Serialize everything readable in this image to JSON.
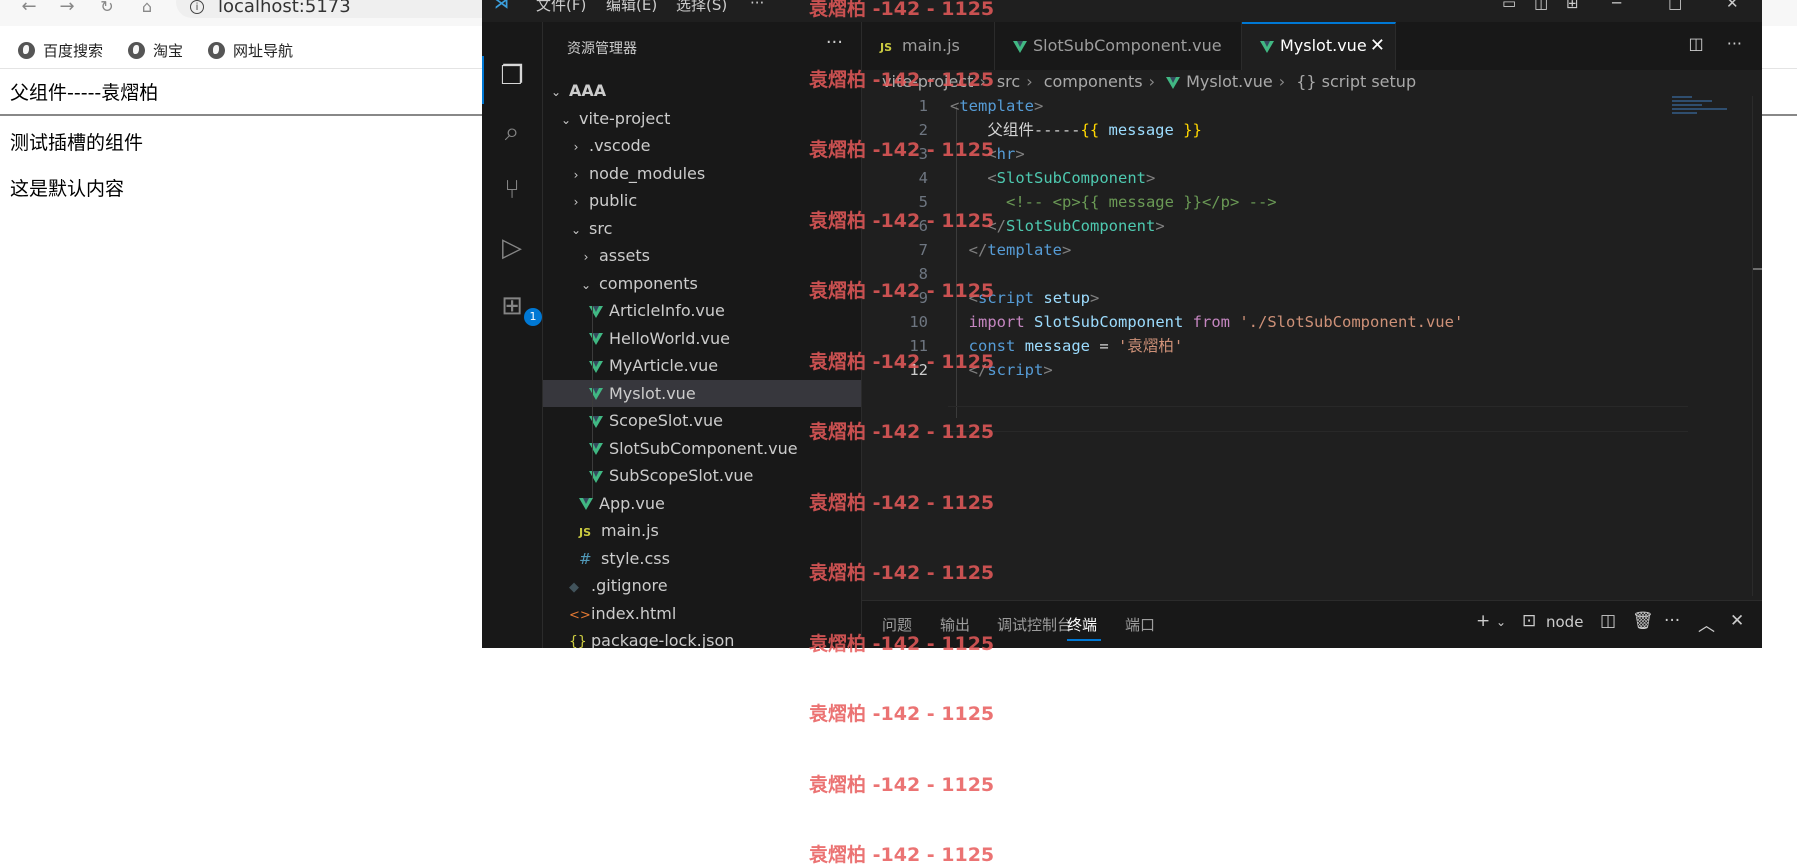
{
  "browser": {
    "url": "localhost:5173",
    "bookmarks": [
      "百度搜索",
      "淘宝",
      "网址导航"
    ]
  },
  "page": {
    "title": "父组件-----袁熠柏",
    "p1": "测试插槽的组件",
    "p2": "这是默认内容"
  },
  "vscode": {
    "menus": [
      "文件(F)",
      "编辑(E)",
      "选择(S)",
      "···"
    ],
    "explorer_title": "资源管理器",
    "more": "···",
    "tree": [
      {
        "label": "AAA",
        "indent": 0,
        "type": "folder-open",
        "bold": true
      },
      {
        "label": "vite-project",
        "indent": 1,
        "type": "folder-open"
      },
      {
        "label": ".vscode",
        "indent": 2,
        "type": "folder"
      },
      {
        "label": "node_modules",
        "indent": 2,
        "type": "folder"
      },
      {
        "label": "public",
        "indent": 2,
        "type": "folder"
      },
      {
        "label": "src",
        "indent": 2,
        "type": "folder-open"
      },
      {
        "label": "assets",
        "indent": 3,
        "type": "folder"
      },
      {
        "label": "components",
        "indent": 3,
        "type": "folder-open"
      },
      {
        "label": "ArticleInfo.vue",
        "indent": 4,
        "type": "vue"
      },
      {
        "label": "HelloWorld.vue",
        "indent": 4,
        "type": "vue"
      },
      {
        "label": "MyArticle.vue",
        "indent": 4,
        "type": "vue"
      },
      {
        "label": "Myslot.vue",
        "indent": 4,
        "type": "vue",
        "selected": true
      },
      {
        "label": "ScopeSlot.vue",
        "indent": 4,
        "type": "vue"
      },
      {
        "label": "SlotSubComponent.vue",
        "indent": 4,
        "type": "vue"
      },
      {
        "label": "SubScopeSlot.vue",
        "indent": 4,
        "type": "vue"
      },
      {
        "label": "App.vue",
        "indent": 3,
        "type": "vue"
      },
      {
        "label": "main.js",
        "indent": 3,
        "type": "js"
      },
      {
        "label": "style.css",
        "indent": 3,
        "type": "css"
      },
      {
        "label": ".gitignore",
        "indent": 2,
        "type": "git"
      },
      {
        "label": "index.html",
        "indent": 2,
        "type": "html"
      },
      {
        "label": "package-lock.json",
        "indent": 2,
        "type": "json"
      }
    ],
    "tabs": [
      {
        "label": "main.js",
        "icon": "js"
      },
      {
        "label": "SlotSubComponent.vue",
        "icon": "vue"
      },
      {
        "label": "Myslot.vue",
        "icon": "vue",
        "active": true
      }
    ],
    "breadcrumb": [
      "vite-project",
      "src",
      "components",
      "Myslot.vue",
      "script setup"
    ],
    "breadcrumb_script_icon": "{}",
    "code_lines": [
      [
        [
          "t-br",
          "<"
        ],
        [
          "t-tag",
          "template"
        ],
        [
          "t-br",
          ">"
        ]
      ],
      [
        [
          "t-txt",
          "    父组件-----"
        ],
        [
          "t-mus",
          "{{ "
        ],
        [
          "t-id",
          "message"
        ],
        [
          "t-mus",
          " }}"
        ]
      ],
      [
        [
          "t-txt",
          "    "
        ],
        [
          "t-br",
          "<"
        ],
        [
          "t-tag",
          "hr"
        ],
        [
          "t-br",
          ">"
        ]
      ],
      [
        [
          "t-txt",
          "    "
        ],
        [
          "t-br",
          "<"
        ],
        [
          "t-cls",
          "SlotSubComponent"
        ],
        [
          "t-br",
          ">"
        ]
      ],
      [
        [
          "t-txt",
          "      "
        ],
        [
          "t-cmt",
          "<!-- <p>{{ message }}</p> -->"
        ]
      ],
      [
        [
          "t-txt",
          "    "
        ],
        [
          "t-br",
          "</"
        ],
        [
          "t-cls",
          "SlotSubComponent"
        ],
        [
          "t-br",
          ">"
        ]
      ],
      [
        [
          "t-txt",
          "  "
        ],
        [
          "t-br",
          "</"
        ],
        [
          "t-tag",
          "template"
        ],
        [
          "t-br",
          ">"
        ]
      ],
      [],
      [
        [
          "t-txt",
          "  "
        ],
        [
          "t-br",
          "<"
        ],
        [
          "t-tag",
          "script"
        ],
        [
          "t-txt",
          " "
        ],
        [
          "t-attr",
          "setup"
        ],
        [
          "t-br",
          ">"
        ]
      ],
      [
        [
          "t-txt",
          "  "
        ],
        [
          "t-kw",
          "import"
        ],
        [
          "t-txt",
          " "
        ],
        [
          "t-id",
          "SlotSubComponent"
        ],
        [
          "t-txt",
          " "
        ],
        [
          "t-kw",
          "from"
        ],
        [
          "t-txt",
          " "
        ],
        [
          "t-str",
          "'./SlotSubComponent.vue'"
        ]
      ],
      [
        [
          "t-txt",
          "  "
        ],
        [
          "t-kw2",
          "const"
        ],
        [
          "t-txt",
          " "
        ],
        [
          "t-id",
          "message"
        ],
        [
          "t-txt",
          " = "
        ],
        [
          "t-str",
          "'袁熠柏'"
        ]
      ],
      [
        [
          "t-txt",
          "  "
        ],
        [
          "t-br",
          "</"
        ],
        [
          "t-tag",
          "script"
        ],
        [
          "t-br",
          ">"
        ]
      ]
    ],
    "current_line": 12,
    "panel_tabs": [
      "问题",
      "输出",
      "调试控制台",
      "终端",
      "端口"
    ],
    "active_panel_tab": "终端",
    "terminal_name": "node",
    "extensions_badge": "1"
  },
  "watermark": {
    "text": "袁熠柏 -142 - 1125",
    "count": 13
  },
  "colors": {
    "vscode_bg": "#1f1f1f",
    "sidebar_bg": "#181818",
    "accent": "#0078d4",
    "vue_green": "#41b883",
    "watermark": "#e85a5a"
  }
}
